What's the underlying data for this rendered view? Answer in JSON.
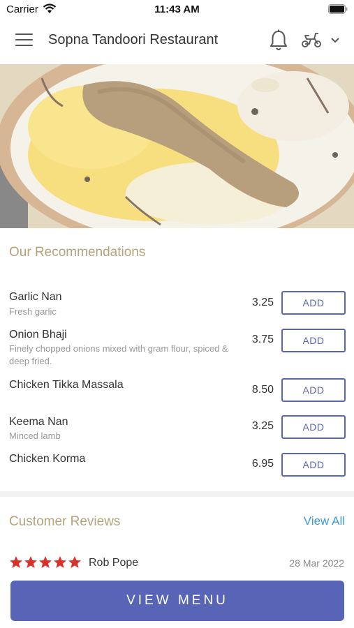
{
  "status_bar": {
    "carrier": "Carrier",
    "time": "11:43 AM"
  },
  "header": {
    "title": "Sopna Tandoori Restaurant",
    "icons": [
      "menu-icon",
      "bell-icon",
      "scooter-icon",
      "chevron-down-icon"
    ]
  },
  "recommendations": {
    "title": "Our Recommendations",
    "items": [
      {
        "name": "Garlic Nan",
        "description": "Fresh garlic",
        "price": "3.25",
        "button": "ADD"
      },
      {
        "name": "Onion Bhaji",
        "description": "Finely chopped onions mixed with gram flour, spiced & deep fried.",
        "price": "3.75",
        "button": "ADD"
      },
      {
        "name": "Chicken Tikka Massala",
        "description": "",
        "price": "8.50",
        "button": "ADD"
      },
      {
        "name": "Keema Nan",
        "description": "Minced lamb",
        "price": "3.25",
        "button": "ADD"
      },
      {
        "name": "Chicken Korma",
        "description": "",
        "price": "6.95",
        "button": "ADD"
      }
    ]
  },
  "reviews": {
    "title": "Customer Reviews",
    "view_all": "View All",
    "items": [
      {
        "reviewer": "Rob Pope",
        "rating": 5,
        "date": "28 Mar 2022"
      }
    ]
  },
  "footer": {
    "view_menu": "VIEW MENU"
  },
  "colors": {
    "accent": "#5864b5",
    "section_title": "#b5a37c",
    "link": "#3a9bd8",
    "star": "#d9322b"
  }
}
